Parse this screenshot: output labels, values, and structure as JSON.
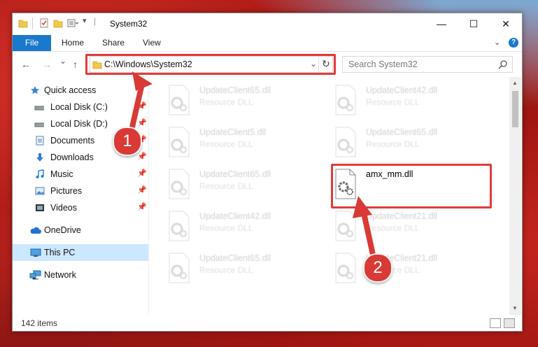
{
  "window": {
    "title": "System32",
    "controls": {
      "minimize": "—",
      "maximize": "☐",
      "close": "✕"
    }
  },
  "ribbon": {
    "tabs": [
      "File",
      "Home",
      "Share",
      "View"
    ],
    "help": "?"
  },
  "navigation": {
    "back": "←",
    "forward": "→",
    "recent": "⌄",
    "up": "↑",
    "address": "C:\\Windows\\System32",
    "refresh": "↻",
    "search_placeholder": "Search System32"
  },
  "sidebar": {
    "items": [
      {
        "label": "Quick access",
        "icon": "star-icon"
      },
      {
        "label": "Local Disk (C:)",
        "icon": "drive-icon",
        "pinned": true
      },
      {
        "label": "Local Disk (D:)",
        "icon": "drive-icon",
        "pinned": true
      },
      {
        "label": "Documents",
        "icon": "document-icon",
        "pinned": true
      },
      {
        "label": "Downloads",
        "icon": "download-icon",
        "pinned": true
      },
      {
        "label": "Music",
        "icon": "music-icon",
        "pinned": true
      },
      {
        "label": "Pictures",
        "icon": "pictures-icon",
        "pinned": true
      },
      {
        "label": "Videos",
        "icon": "video-icon",
        "pinned": true
      },
      {
        "label": "OneDrive",
        "icon": "cloud-icon"
      },
      {
        "label": "This PC",
        "icon": "computer-icon",
        "selected": true
      },
      {
        "label": "Network",
        "icon": "network-icon"
      }
    ]
  },
  "files": [
    {
      "name": "UpdateClient65.dll",
      "type": "Resource DLL"
    },
    {
      "name": "UpdateClient42.dll",
      "type": "Resource DLL"
    },
    {
      "name": "UpdateClient5.dll",
      "type": "Resource DLL"
    },
    {
      "name": "UpdateClient65.dll",
      "type": "Resource DLL"
    },
    {
      "name": "UpdateClient65.dll",
      "type": "Resource DLL"
    },
    {
      "name": "amx_mm.dll",
      "type": ""
    },
    {
      "name": "UpdateClient42.dll",
      "type": "Resource DLL"
    },
    {
      "name": "UpdateClient21.dll",
      "type": "Resource DLL"
    },
    {
      "name": "UpdateClient65.dll",
      "type": "Resource DLL"
    },
    {
      "name": "UpdateClient21.dll",
      "type": "Resource DLL"
    }
  ],
  "status": {
    "item_count": "142 items"
  },
  "annotations": {
    "step1": "1",
    "step2": "2",
    "color": "#e23b3b"
  }
}
